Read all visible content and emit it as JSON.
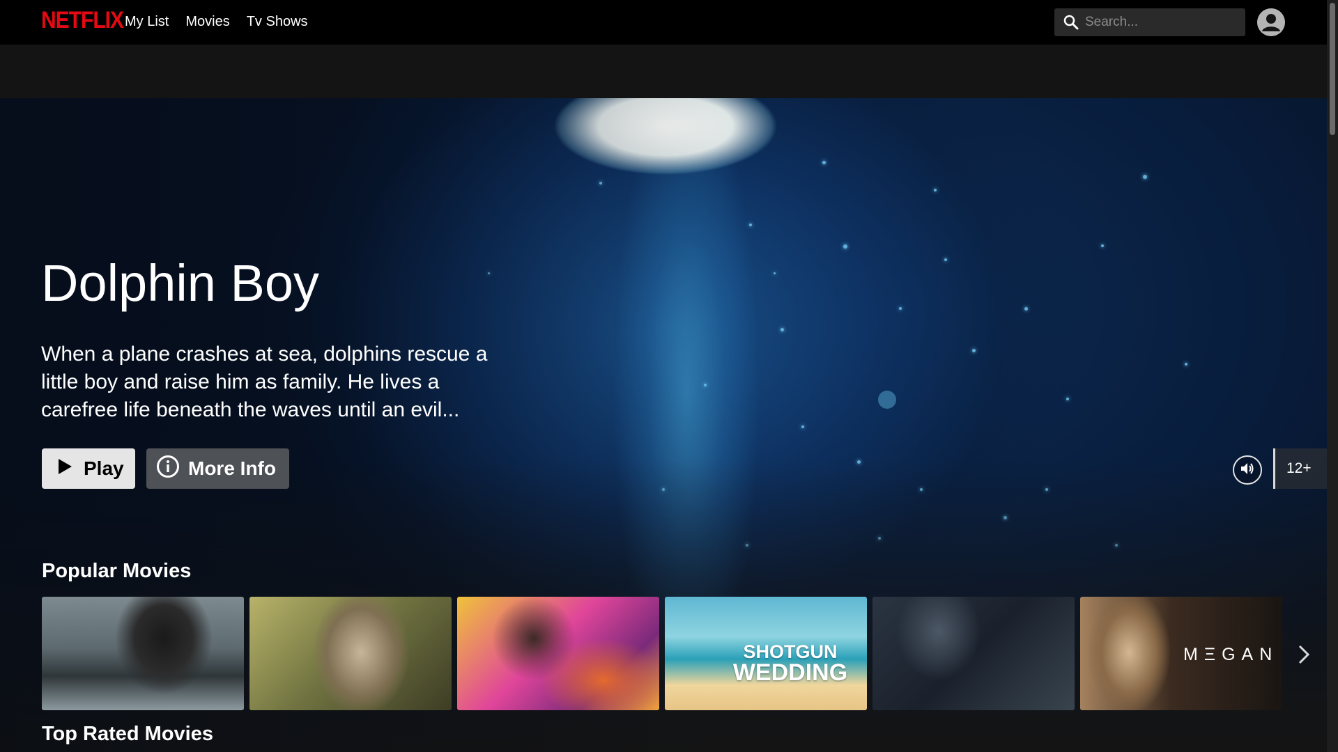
{
  "app": {
    "logo_text": "NETFLIX",
    "brand_color": "#e50914"
  },
  "nav": {
    "links": [
      "My List",
      "Movies",
      "Tv Shows"
    ],
    "search_placeholder": "Search..."
  },
  "hero": {
    "title": "Dolphin Boy",
    "description": "When a plane crashes at sea, dolphins rescue a little boy and raise him as family. He lives a carefree life beneath the waves until an evil...",
    "play_label": "Play",
    "info_label": "More Info",
    "maturity_rating": "12+"
  },
  "rows": [
    {
      "title": "Popular Movies",
      "tiles": [
        {
          "overlay_text": ""
        },
        {
          "overlay_text": ""
        },
        {
          "overlay_text": ""
        },
        {
          "overlay_text": [
            "SHOTGUN",
            "WEDDING"
          ]
        },
        {
          "overlay_text": ""
        },
        {
          "overlay_text": "MΞGAN"
        }
      ]
    },
    {
      "title": "Top Rated Movies"
    }
  ],
  "icons": {
    "search": "search-icon",
    "avatar": "user-avatar-icon",
    "play": "play-icon",
    "info": "info-icon",
    "volume": "volume-icon",
    "next": "chevron-right-icon"
  }
}
